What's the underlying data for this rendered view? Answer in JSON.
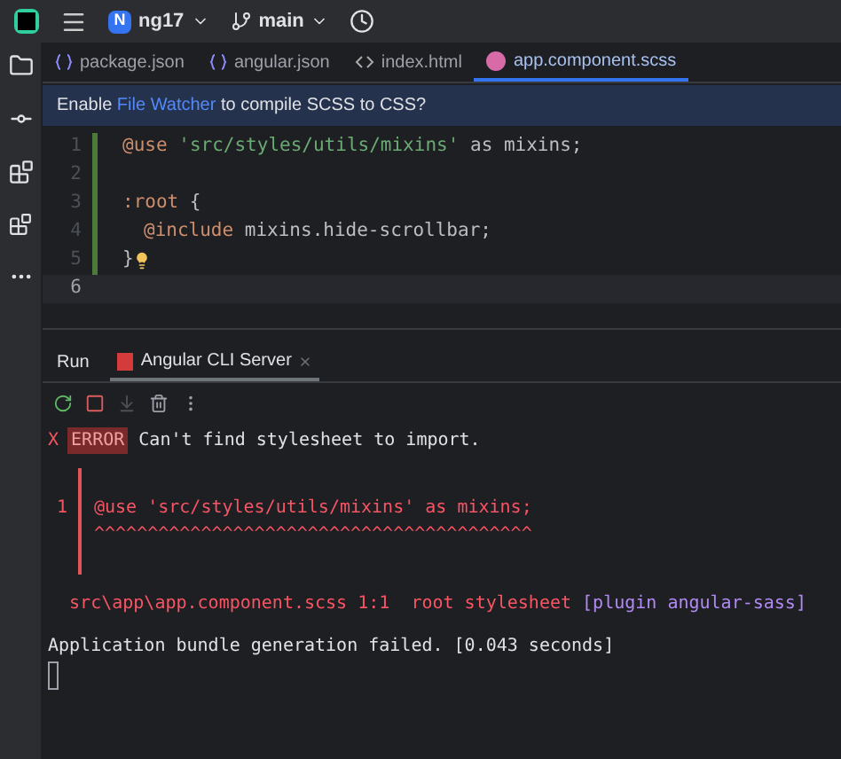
{
  "toolbar": {
    "project_badge": "N",
    "project": "ng17",
    "branch": "main"
  },
  "tabs": [
    {
      "label": "package.json",
      "kind": "json",
      "selected": false
    },
    {
      "label": "angular.json",
      "kind": "json",
      "selected": false
    },
    {
      "label": "index.html",
      "kind": "html",
      "selected": false
    },
    {
      "label": "app.component.scss",
      "kind": "scss",
      "selected": true
    }
  ],
  "banner": {
    "before": "Enable ",
    "link": "File Watcher",
    "after": " to compile SCSS to CSS?"
  },
  "editor": {
    "lines": [
      {
        "number": "1",
        "modified": true,
        "current": false,
        "bulb": false,
        "tokens": [
          {
            "text": "@use",
            "kind": "keyword"
          },
          {
            "text": " 'src/styles/utils/mixins'",
            "kind": "string"
          },
          {
            "text": " as mixins;",
            "kind": "plain"
          }
        ]
      },
      {
        "number": "2",
        "modified": true,
        "current": false,
        "bulb": false
      },
      {
        "number": "3",
        "modified": true,
        "current": false,
        "bulb": false,
        "tokens": [
          {
            "text": ":root",
            "kind": "keyword"
          },
          {
            "text": " {",
            "kind": "plain"
          }
        ]
      },
      {
        "number": "4",
        "modified": true,
        "current": false,
        "bulb": false,
        "indent": true,
        "tokens": [
          {
            "text": "@include",
            "kind": "keyword"
          },
          {
            "text": " mixins.hide-scrollbar;",
            "kind": "plain"
          }
        ]
      },
      {
        "number": "5",
        "modified": true,
        "current": false,
        "bulb": true,
        "tokens": [
          {
            "text": "}",
            "kind": "plain"
          }
        ]
      },
      {
        "number": "6",
        "modified": false,
        "current": true,
        "bulb": false
      }
    ]
  },
  "run_panel": {
    "title": "Run",
    "tabs": [
      {
        "label": "Angular CLI Server",
        "selected": true
      }
    ],
    "console": [
      {
        "kind": "error",
        "mark": "X",
        "tag": "ERROR",
        "text": " Can't find stylesheet to import."
      },
      {
        "kind": "blank"
      },
      {
        "kind": "pipe"
      },
      {
        "kind": "pipe",
        "number": "1",
        "text": "@use 'src/styles/utils/mixins' as mixins;"
      },
      {
        "kind": "pipe",
        "text": "^^^^^^^^^^^^^^^^^^^^^^^^^^^^^^^^^^^^^^^^^"
      },
      {
        "kind": "pipe"
      },
      {
        "kind": "blank"
      },
      {
        "kind": "location",
        "text": "  src\\app\\app.component.scss 1:1  root stylesheet ",
        "plugin": "[plugin angular-sass]"
      },
      {
        "kind": "blank"
      },
      {
        "kind": "info",
        "text": "Application bundle generation failed. [0.043 seconds]"
      },
      {
        "kind": "cursor"
      }
    ]
  }
}
